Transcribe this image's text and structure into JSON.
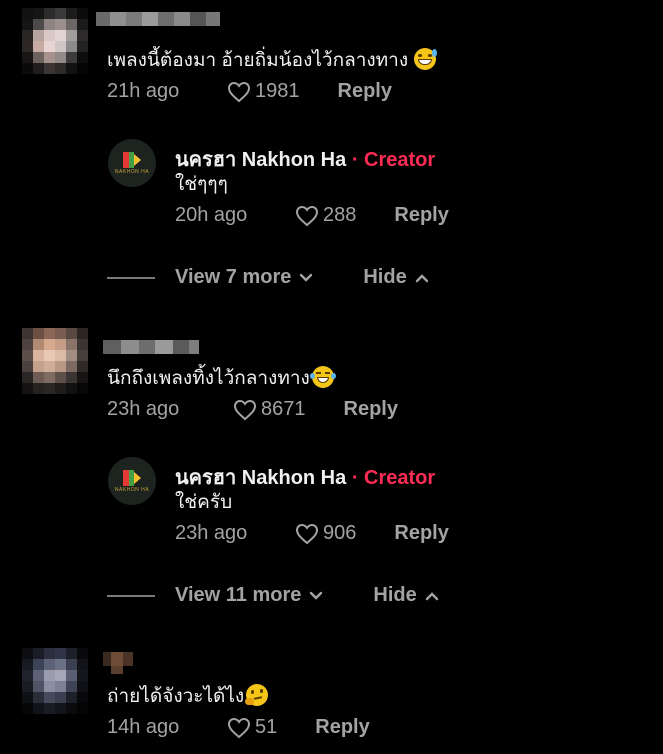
{
  "comments": [
    {
      "text": "เพลงนี้ต้องมา อ้ายถิ่มน้องไว้กลางทาง",
      "emoji": "grinning-sweat-emoji",
      "time": "21h ago",
      "likes": "1981",
      "reply_label": "Reply",
      "creator_reply": {
        "name": "นครฮา Nakhon Ha",
        "separator": "·",
        "badge": "Creator",
        "text": "ใช่ๆๆๆ",
        "time": "20h ago",
        "likes": "288",
        "reply_label": "Reply"
      },
      "view_more": "View 7 more",
      "hide": "Hide"
    },
    {
      "text": "นึกถึงเพลงทิ้งไว้กลางทาง",
      "emoji": "tears-of-joy-emoji",
      "time": "23h ago",
      "likes": "8671",
      "reply_label": "Reply",
      "creator_reply": {
        "name": "นครฮา Nakhon Ha",
        "separator": "·",
        "badge": "Creator",
        "text": "ใช่ครับ",
        "time": "23h ago",
        "likes": "906",
        "reply_label": "Reply"
      },
      "view_more": "View 11 more",
      "hide": "Hide"
    },
    {
      "text": "ถ่ายได้จังวะได้ไง",
      "emoji": "thinking-face-emoji",
      "time": "14h ago",
      "likes": "51",
      "reply_label": "Reply"
    }
  ],
  "creator_logo_text": "NAKHON HA",
  "colors": {
    "background": "#000000",
    "creator_badge": "#fe2c55",
    "muted": "#a3a3a3"
  }
}
